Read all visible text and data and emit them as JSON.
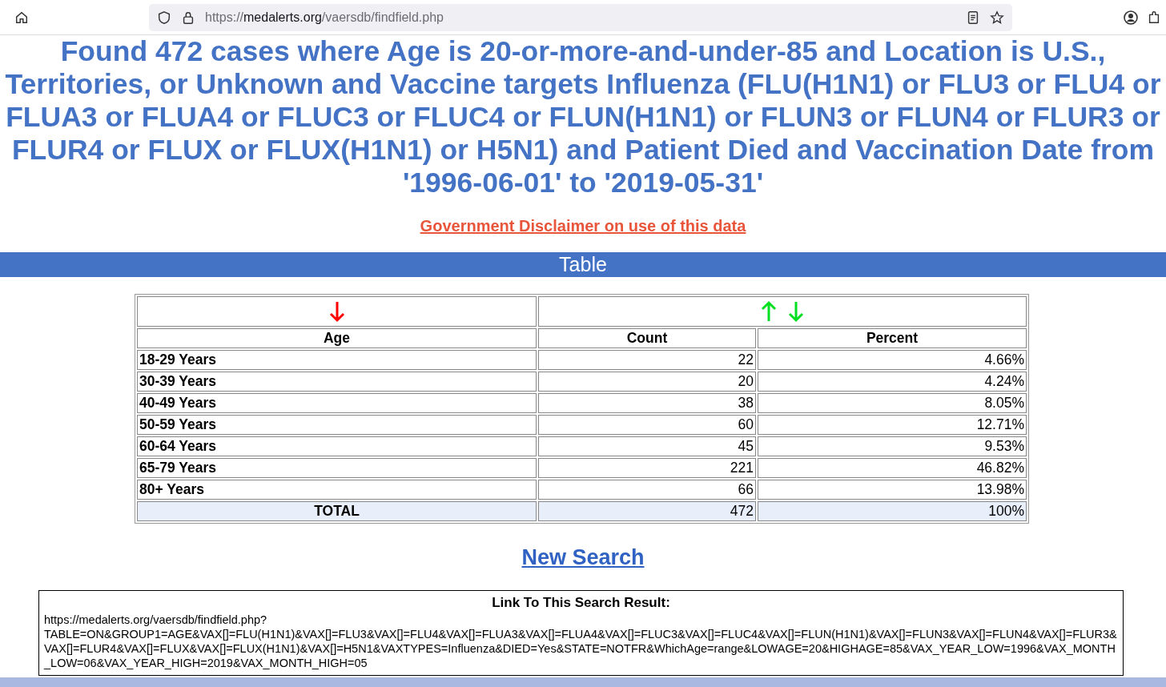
{
  "browser": {
    "url_prefix": "https://",
    "url_domain": "medalerts.org",
    "url_path": "/vaersdb/findfield.php"
  },
  "heading": "Found 472 cases where Age is 20-or-more-and-under-85 and Location is U.S., Territories, or Unknown and Vaccine targets Influenza (FLU(H1N1) or FLU3 or FLU4 or FLUA3 or FLUA4 or FLUC3 or FLUC4 or FLUN(H1N1) or FLUN3 or FLUN4 or FLUR3 or FLUR4 or FLUX or FLUX(H1N1) or H5N1) and Patient Died and Vaccination Date from '1996-06-01' to '2019-05-31'",
  "disclaimer_link": "Government Disclaimer on use of this data",
  "section_bar": "Table",
  "table": {
    "sort_cells": [
      {
        "arrows": [
          {
            "kind": "down",
            "active": true
          }
        ]
      },
      {
        "arrows": [
          {
            "kind": "up",
            "active": false
          },
          {
            "kind": "down",
            "active": false
          }
        ]
      }
    ],
    "columns": [
      "Age",
      "Count",
      "Percent"
    ],
    "rows": [
      [
        "18-29 Years",
        "22",
        "4.66%"
      ],
      [
        "30-39 Years",
        "20",
        "4.24%"
      ],
      [
        "40-49 Years",
        "38",
        "8.05%"
      ],
      [
        "50-59 Years",
        "60",
        "12.71%"
      ],
      [
        "60-64 Years",
        "45",
        "9.53%"
      ],
      [
        "65-79 Years",
        "221",
        "46.82%"
      ],
      [
        "80+ Years",
        "66",
        "13.98%"
      ]
    ],
    "total": [
      "TOTAL",
      "472",
      "100%"
    ]
  },
  "new_search_link": "New Search",
  "link_box": {
    "title": "Link To This Search Result:",
    "url_line": "https://medalerts.org/vaersdb/findfield.php?",
    "params": "TABLE=ON&GROUP1=AGE&VAX[]=FLU(H1N1)&VAX[]=FLU3&VAX[]=FLU4&VAX[]=FLUA3&VAX[]=FLUA4&VAX[]=FLUC3&VAX[]=FLUC4&VAX[]=FLUN(H1N1)&VAX[]=FLUN3&VAX[]=FLUN4&VAX[]=FLUR3&VAX[]=FLUR4&VAX[]=FLUX&VAX[]=FLUX(H1N1)&VAX[]=H5N1&VAXTYPES=Influenza&DIED=Yes&STATE=NOTFR&WhichAge=range&LOWAGE=20&HIGHAGE=85&VAX_YEAR_LOW=1996&VAX_MONTH_LOW=06&VAX_YEAR_HIGH=2019&VAX_MONTH_HIGH=05"
  }
}
